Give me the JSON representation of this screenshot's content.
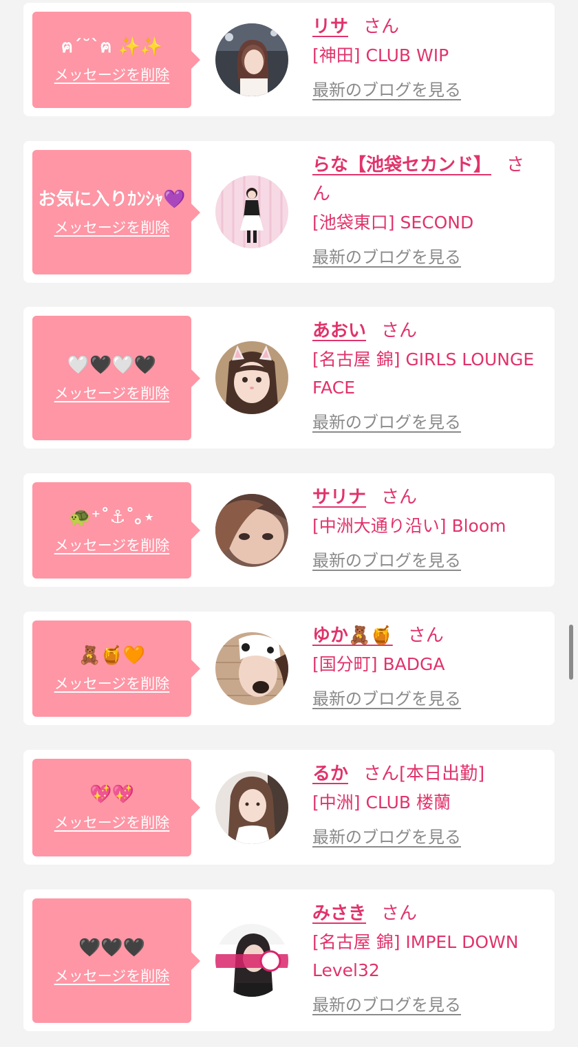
{
  "delete_label": "メッセージを削除",
  "san_label": "さん",
  "blog_label": "最新のブログを見る",
  "colors": {
    "accent": "#e0336b",
    "bubble": "#ff96a5",
    "background": "#f3f3f3"
  },
  "favorites": [
    {
      "message": "ฅ´˘`ฅ ✨✨",
      "name": "リサ",
      "suffix": "",
      "shop": "[神田] CLUB WIP",
      "avatar": "photo-portrait"
    },
    {
      "message": "お気に入りｶﾝｼｬ💜",
      "name": "らな【池袋セカンド】",
      "suffix": "",
      "shop": "[池袋東口] SECOND",
      "avatar": "photo-maid-full-body"
    },
    {
      "message": "🤍🖤🤍🖤",
      "name": "あおい",
      "suffix": "",
      "shop": "[名古屋 錦] GIRLS LOUNGE FACE",
      "avatar": "photo-cat-ear-filter"
    },
    {
      "message": "🐢⁺˚⚓︎˚｡⋆",
      "name": "サリナ",
      "suffix": "",
      "shop": "[中洲大通り沿い] Bloom",
      "avatar": "photo-closeup"
    },
    {
      "message": "🧸🍯🧡",
      "name": "ゆか🧸🍯",
      "suffix": "",
      "shop": "[国分町] BADGA",
      "avatar": "photo-dog-filter"
    },
    {
      "message": "💖💖",
      "name": "るか",
      "suffix": "[本日出勤]",
      "shop": "[中洲] CLUB 楼蘭",
      "avatar": "photo-portrait"
    },
    {
      "message": "🖤🖤🖤",
      "name": "みさき",
      "suffix": "",
      "shop": "[名古屋 錦] IMPEL DOWN Level32",
      "avatar": "photo-banner"
    }
  ]
}
